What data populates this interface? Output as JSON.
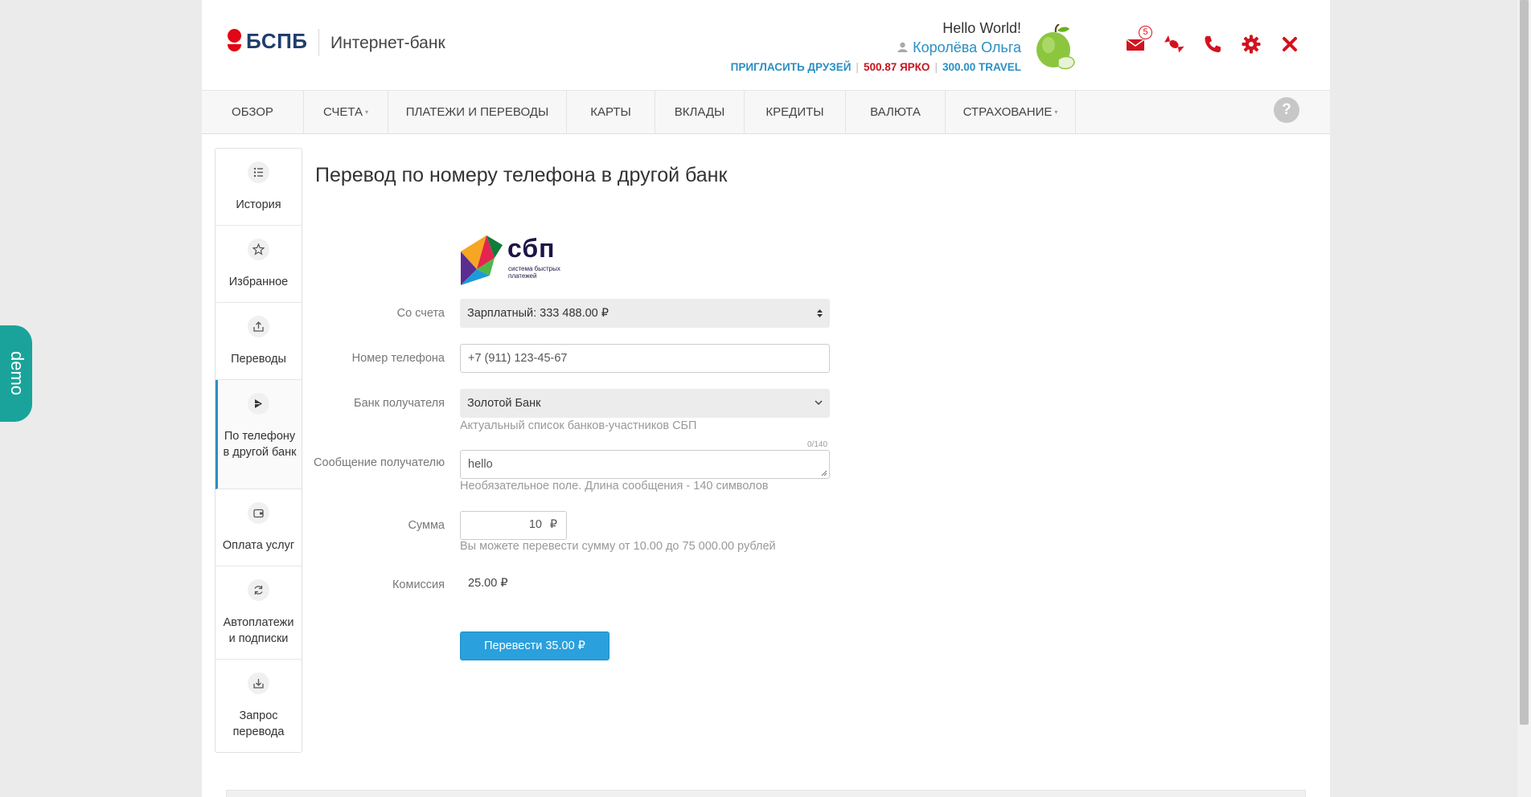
{
  "brand": {
    "logo_text": "БСПБ",
    "subtitle": "Интернет-банк",
    "logo_color": "#e30613"
  },
  "user": {
    "greeting": "Hello World!",
    "name": "Королёва Ольга",
    "invite": "ПРИГЛАСИТЬ ДРУЗЕЙ",
    "yarko": "500.87 ЯРКО",
    "travel": "300.00 TRAVEL",
    "separator": "|"
  },
  "header_icons": [
    {
      "name": "mail-icon",
      "badge": "5"
    },
    {
      "name": "candy-icon"
    },
    {
      "name": "phone-icon"
    },
    {
      "name": "gear-icon"
    },
    {
      "name": "close-icon"
    }
  ],
  "nav": [
    {
      "label": "ОБЗОР"
    },
    {
      "label": "СЧЕТА",
      "caret": "▾"
    },
    {
      "label": "ПЛАТЕЖИ И ПЕРЕВОДЫ"
    },
    {
      "label": "КАРТЫ"
    },
    {
      "label": "ВКЛАДЫ"
    },
    {
      "label": "КРЕДИТЫ"
    },
    {
      "label": "ВАЛЮТА"
    },
    {
      "label": "СТРАХОВАНИЕ",
      "caret": "▾"
    }
  ],
  "help_label": "?",
  "sidebar": [
    {
      "label": "История",
      "icon": "list-icon"
    },
    {
      "label": "Избранное",
      "icon": "star-icon"
    },
    {
      "label": "Переводы",
      "icon": "transfer-icon"
    },
    {
      "label": "По телефону в другой банк",
      "icon": "sbp-icon",
      "active": true
    },
    {
      "label": "Оплата услуг",
      "icon": "wallet-icon"
    },
    {
      "label": "Автоплатежи и подписки",
      "icon": "refresh-icon"
    },
    {
      "label": "Запрос перевода",
      "icon": "request-icon"
    }
  ],
  "form": {
    "title": "Перевод по номеру телефона в другой банк",
    "logo_text": "сбп",
    "logo_sub_1": "система быстрых",
    "logo_sub_2": "платежей",
    "account_label": "Со счета",
    "account_value": "Зарплатный: 333 488.00 ₽",
    "phone_label": "Номер телефона",
    "phone_value": "+7 (911) 123-45-67",
    "bank_label": "Банк получателя",
    "bank_value": "Золотой Банк",
    "bank_hint": "Актуальный список банков-участников СБП",
    "message_label": "Сообщение получателю",
    "message_counter": "0/140",
    "message_value": "hello",
    "message_hint": "Необязательное поле. Длина сообщения - 140 символов",
    "amount_label": "Сумма",
    "amount_value": "10",
    "currency": "₽",
    "amount_hint": "Вы можете перевести сумму от 10.00 до 75 000.00 рублей",
    "fee_label": "Комиссия",
    "fee_value": "25.00 ₽",
    "submit_label": "Перевести 35.00 ₽"
  },
  "demo_label": "demo",
  "colors": {
    "accent": "#2a8fc3",
    "button": "#2aa0dc",
    "red": "#d3121f",
    "demo": "#1aa39a"
  }
}
